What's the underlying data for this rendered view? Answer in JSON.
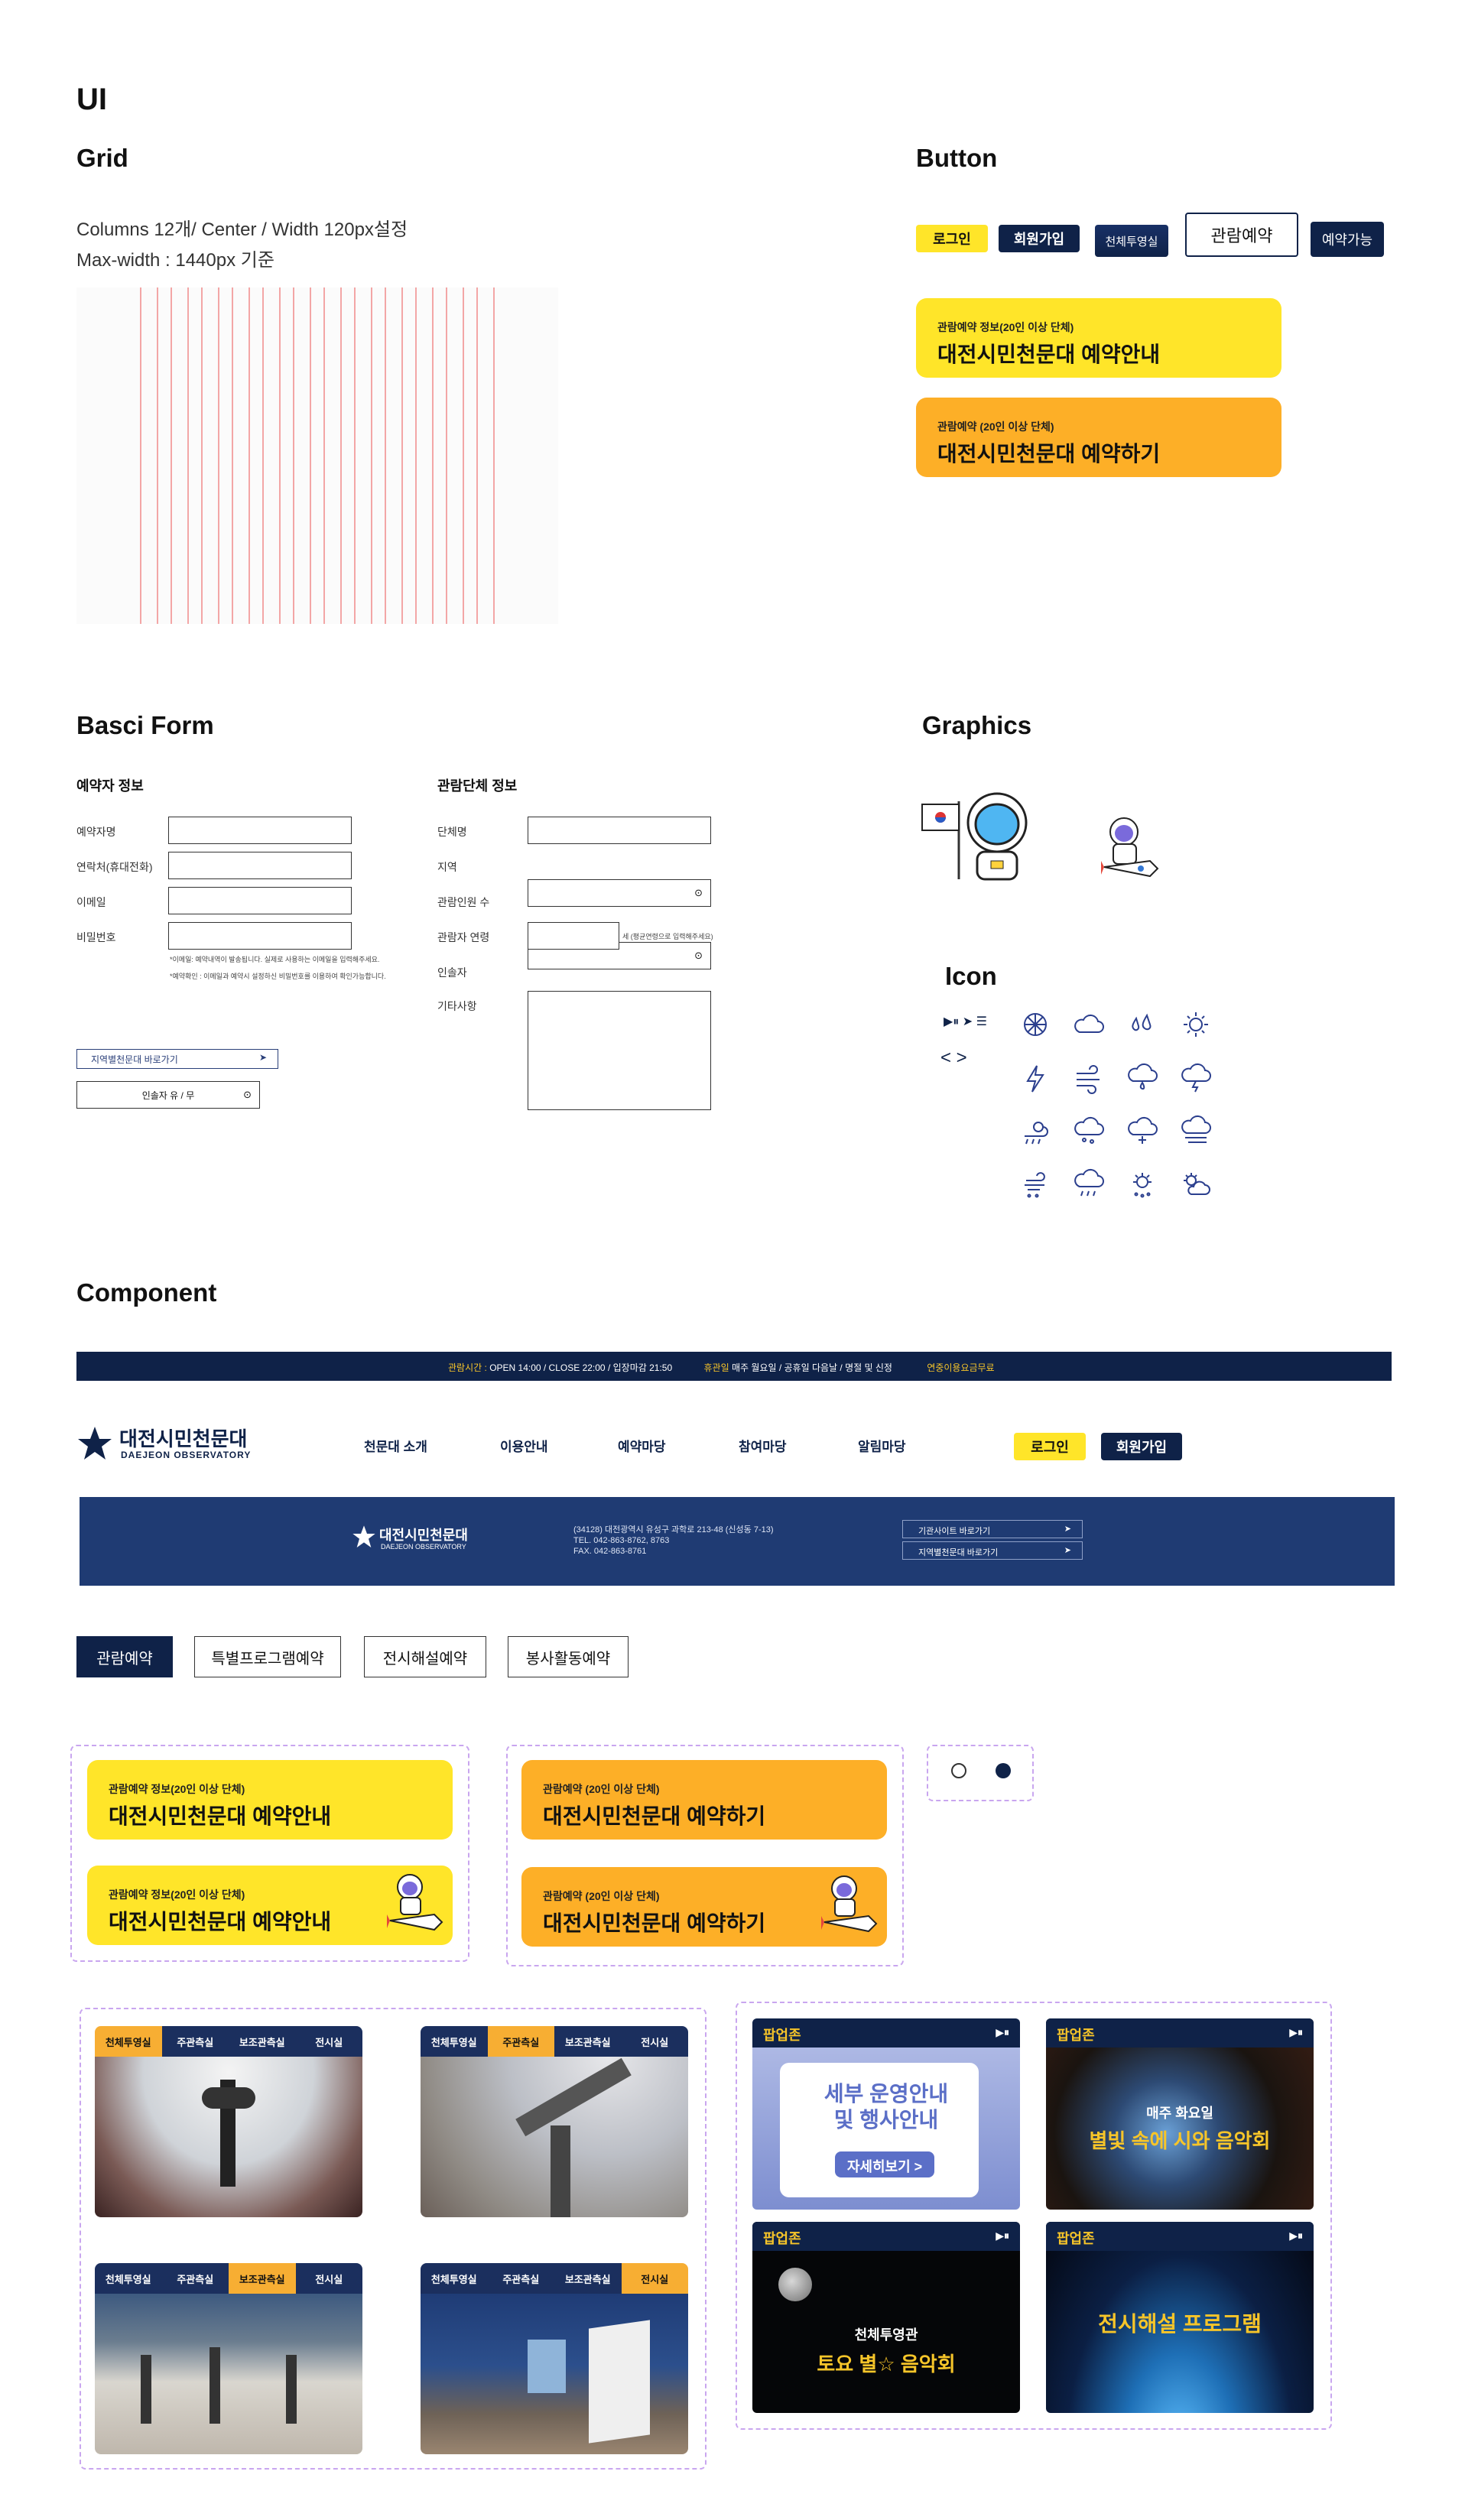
{
  "page_title": "UI",
  "grid": {
    "title": "Grid",
    "line1": "Columns  12개/ Center / Width 120px설정",
    "line2": "Max-width : 1440px 기준"
  },
  "button": {
    "title": "Button",
    "login": "로그인",
    "join": "회원가입",
    "planet": "천체투영실",
    "reserve": "관람예약",
    "available": "예약가능",
    "cta1_small": "관람예약 정보(20인 이상 단체)",
    "cta1_big": "대전시민천문대 예약안내",
    "cta2_small": "관람예약 (20인 이상 단체)",
    "cta2_big": "대전시민천문대 예약하기"
  },
  "form": {
    "title": "Basci Form",
    "left_heading": "예약자 정보",
    "right_heading": "관람단체 정보",
    "left_labels": [
      "예약자명",
      "연락처(휴대전화)",
      "이메일",
      "비밀번호"
    ],
    "notes": [
      "*이메일: 예약내역이 발송됩니다. 실제로 사용하는 이메일을 입력해주세요.",
      "*예약확인 : 이메일과 예약시 설정하신 비밀번호를 이용하여 확인가능합니다."
    ],
    "link_label": "지역별천문대 바로가기",
    "leader_select": "인솔자 유 / 무",
    "right_labels": [
      "단체명",
      "지역",
      "관람인원 수",
      "관람자 연령",
      "인솔자",
      "기타사항"
    ],
    "age_hint": "세 (평균연령으로 입력해주세요)"
  },
  "graphics": {
    "title": "Graphics"
  },
  "icon": {
    "title": "Icon",
    "media": "▶⏸ ➤ ☰",
    "arrows": "< >"
  },
  "component": {
    "title": "Component",
    "topbar": {
      "time_label": "관람시간 :",
      "time_value": "OPEN 14:00 / CLOSE 22:00 / 입장마감 21:50",
      "closed_label": "휴관일",
      "closed_value": "매주 월요일 / 공휴일 다음날 / 명절 및 신정",
      "fee": "연중이용요금무료"
    },
    "header": {
      "logo_ko": "대전시민천문대",
      "logo_en": "DAEJEON OBSERVATORY",
      "nav": [
        "천문대 소개",
        "이용안내",
        "예약마당",
        "참여마당",
        "알림마당"
      ],
      "login": "로그인",
      "join": "회원가입"
    },
    "footer": {
      "logo_ko": "대전시민천문대",
      "logo_en": "DAEJEON OBSERVATORY",
      "address": "(34128) 대전광역시 유성구 과학로 213-48 (신성동 7-13)",
      "tel": "TEL. 042-863-8762, 8763",
      "fax": "FAX. 042-863-8761",
      "link1": "기관사이트 바로가기",
      "link2": "지역별천문대 바로가기"
    },
    "tabs": [
      "관람예약",
      "특별프로그램예약",
      "전시해설예약",
      "봉사활동예약"
    ],
    "facility_tabs": [
      "천체투영실",
      "주관측실",
      "보조관측실",
      "전시실"
    ],
    "popup_label": "팝업존",
    "popups": [
      {
        "line1": "세부 운영안내",
        "line2": "및 행사안내",
        "button": "자세히보기 >"
      },
      {
        "line1": "매주 화요일",
        "line2": "별빛 속에 시와 음악회"
      },
      {
        "line1": "천체투영관",
        "line2": "토요 별☆ 음악회"
      },
      {
        "line1": "전시해설 프로그램"
      }
    ]
  },
  "colors": {
    "navy": "#0f2248",
    "yellow": "#ffe529",
    "orange": "#fdaf27",
    "accent_yellow": "#f7c529"
  }
}
